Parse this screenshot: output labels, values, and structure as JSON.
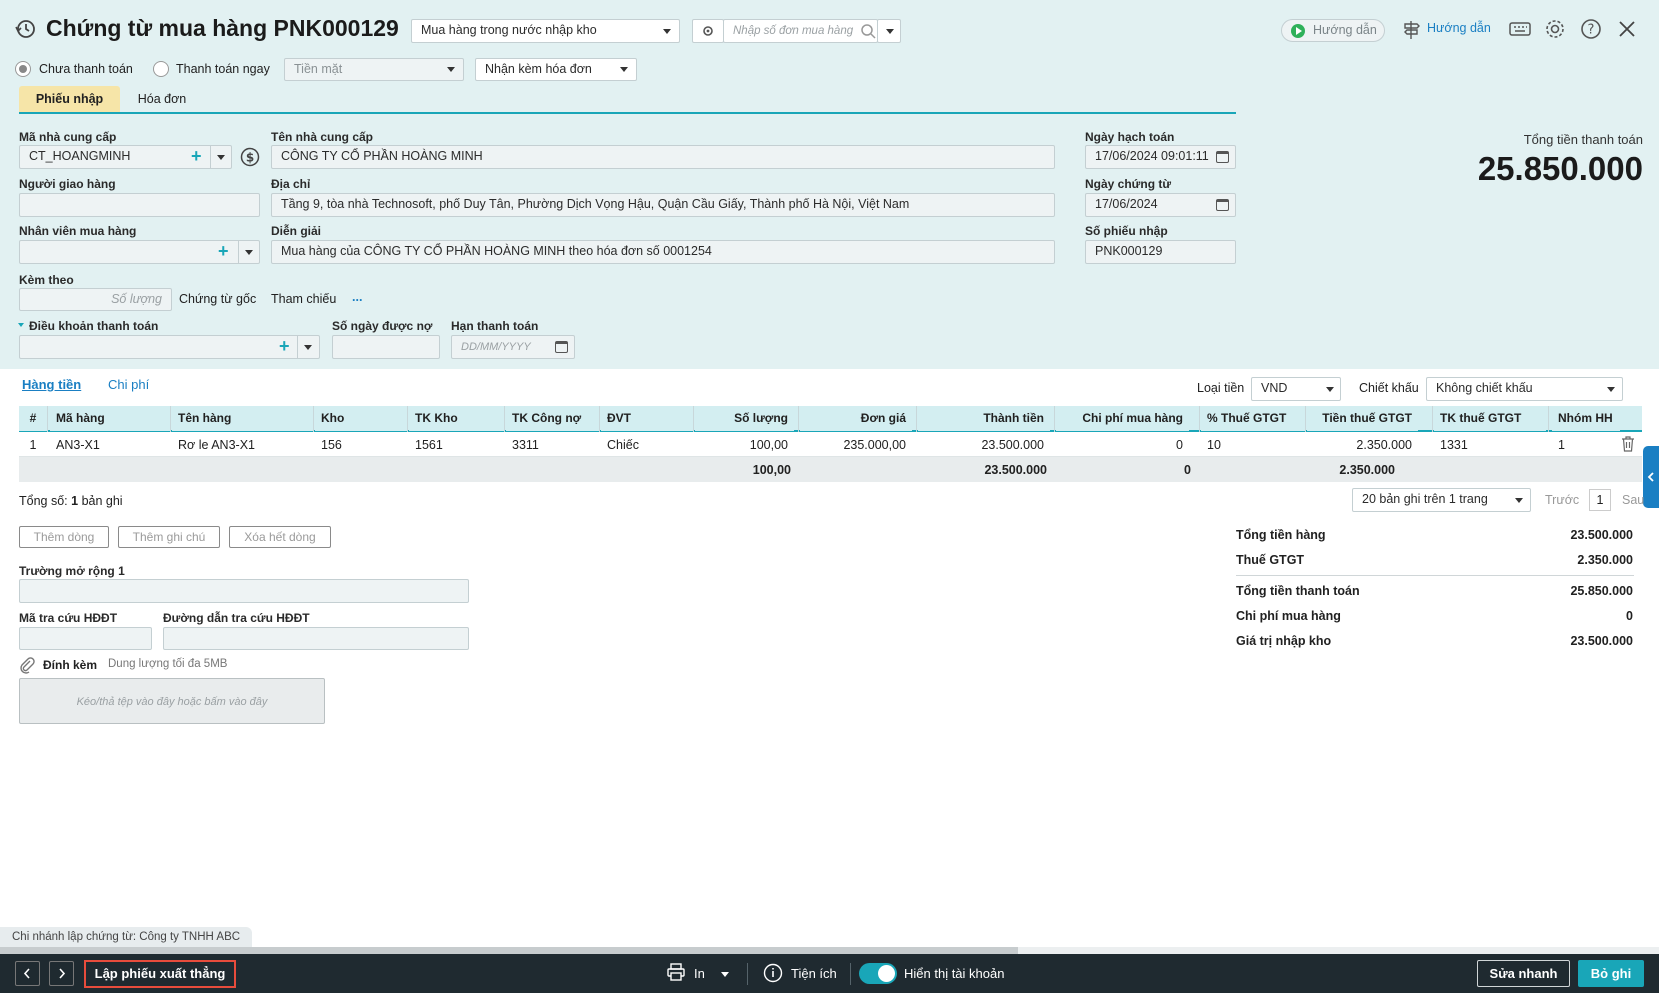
{
  "header": {
    "title": "Chứng từ mua hàng PNK000129",
    "purchase_type": "Mua hàng trong nước nhập kho",
    "order_search_placeholder": "Nhập số đơn mua hàng",
    "guide_video_label": "Hướng dẫn",
    "guide_label": "Hướng dẫn"
  },
  "payment": {
    "option_unpaid": "Chưa thanh toán",
    "option_paid_now": "Thanh toán ngay",
    "method": "Tiền mặt",
    "invoice_option": "Nhận kèm hóa đơn"
  },
  "tabs": [
    "Phiếu nhập",
    "Hóa đơn"
  ],
  "form": {
    "supplier_code_label": "Mã nhà cung cấp",
    "supplier_code": "CT_HOANGMINH",
    "supplier_name_label": "Tên nhà cung cấp",
    "supplier_name": "CÔNG TY CỔ PHẦN HOÀNG MINH",
    "deliverer_label": "Người giao hàng",
    "address_label": "Địa chỉ",
    "address": "Tầng 9, tòa nhà Technosoft, phố Duy Tân, Phường Dịch Vọng Hậu, Quận Cầu Giấy, Thành phố Hà Nội, Việt Nam",
    "buyer_label": "Nhân viên mua hàng",
    "description_label": "Diễn giải",
    "description": "Mua hàng của CÔNG TY CỔ PHẦN HOÀNG MINH theo hóa đơn số 0001254",
    "attached_label": "Kèm theo",
    "quantity_placeholder": "Số lượng",
    "original_docs": "Chứng từ gốc",
    "reference": "Tham chiếu",
    "more": "...",
    "payment_terms_label": "Điều khoản thanh toán",
    "credit_days_label": "Số ngày được nợ",
    "due_date_label": "Hạn thanh toán",
    "due_date_placeholder": "DD/MM/YYYY",
    "posting_date_label": "Ngày hạch toán",
    "posting_date": "17/06/2024 09:01:11",
    "doc_date_label": "Ngày chứng từ",
    "doc_date": "17/06/2024",
    "receipt_no_label": "Số phiếu nhập",
    "receipt_no": "PNK000129"
  },
  "total_box": {
    "label": "Tổng tiền thanh toán",
    "value": "25.850.000"
  },
  "detail_tabs": [
    "Hàng tiền",
    "Chi phí"
  ],
  "currency": {
    "label": "Loại tiền",
    "value": "VND"
  },
  "discount": {
    "label": "Chiết khấu",
    "value": "Không chiết khấu"
  },
  "grid": {
    "columns": [
      "#",
      "Mã hàng",
      "Tên hàng",
      "Kho",
      "TK Kho",
      "TK Công nợ",
      "ĐVT",
      "Số lượng",
      "Đơn giá",
      "Thành tiền",
      "Chi phí mua hàng",
      "% Thuế GTGT",
      "Tiền thuế GTGT",
      "TK thuế GTGT",
      "Nhóm HH"
    ],
    "rows": [
      [
        "1",
        "AN3-X1",
        "Rơ le AN3-X1",
        "156",
        "1561",
        "3311",
        "Chiếc",
        "100,00",
        "235.000,00",
        "23.500.000",
        "0",
        "10",
        "2.350.000",
        "1331",
        "1"
      ]
    ],
    "totals": {
      "quantity": "100,00",
      "amount": "23.500.000",
      "purchase_cost": "0",
      "vat": "2.350.000"
    }
  },
  "pager": {
    "total_prefix": "Tổng số:",
    "total_count": "1",
    "total_suffix": "bản ghi",
    "page_size": "20 bản ghi trên 1 trang",
    "prev": "Trước",
    "page": "1",
    "next": "Sau"
  },
  "row_buttons": [
    "Thêm dòng",
    "Thêm ghi chú",
    "Xóa hết dòng"
  ],
  "extra": {
    "ext_field_label": "Trường mở rộng 1",
    "einvoice_code_label": "Mã tra cứu HĐĐT",
    "einvoice_link_label": "Đường dẫn tra cứu HĐĐT",
    "attach_label": "Đính kèm",
    "attach_limit": "Dung lượng tối đa 5MB",
    "drop_hint": "Kéo/thả tệp vào đây hoặc bấm vào đây"
  },
  "summary": [
    {
      "label": "Tổng tiền hàng",
      "value": "23.500.000"
    },
    {
      "label": "Thuế GTGT",
      "value": "2.350.000"
    },
    {
      "label": "Tổng tiền thanh toán",
      "value": "25.850.000"
    },
    {
      "label": "Chi phí mua hàng",
      "value": "0"
    },
    {
      "label": "Giá trị nhập kho",
      "value": "23.500.000"
    }
  ],
  "branch_note": "Chi nhánh lập chứng từ: Công ty TNHH ABC",
  "footer": {
    "create_export": "Lập phiếu xuất thẳng",
    "print": "In",
    "utilities": "Tiện ích",
    "show_accounts": "Hiển thị tài khoản",
    "quick_edit": "Sửa nhanh",
    "discard": "Bỏ ghi"
  },
  "colors": {
    "accent": "#19a6b8",
    "header_bg": "#e2f1f2",
    "footer_bg": "#1f2a30",
    "highlight": "#e74c3c"
  }
}
